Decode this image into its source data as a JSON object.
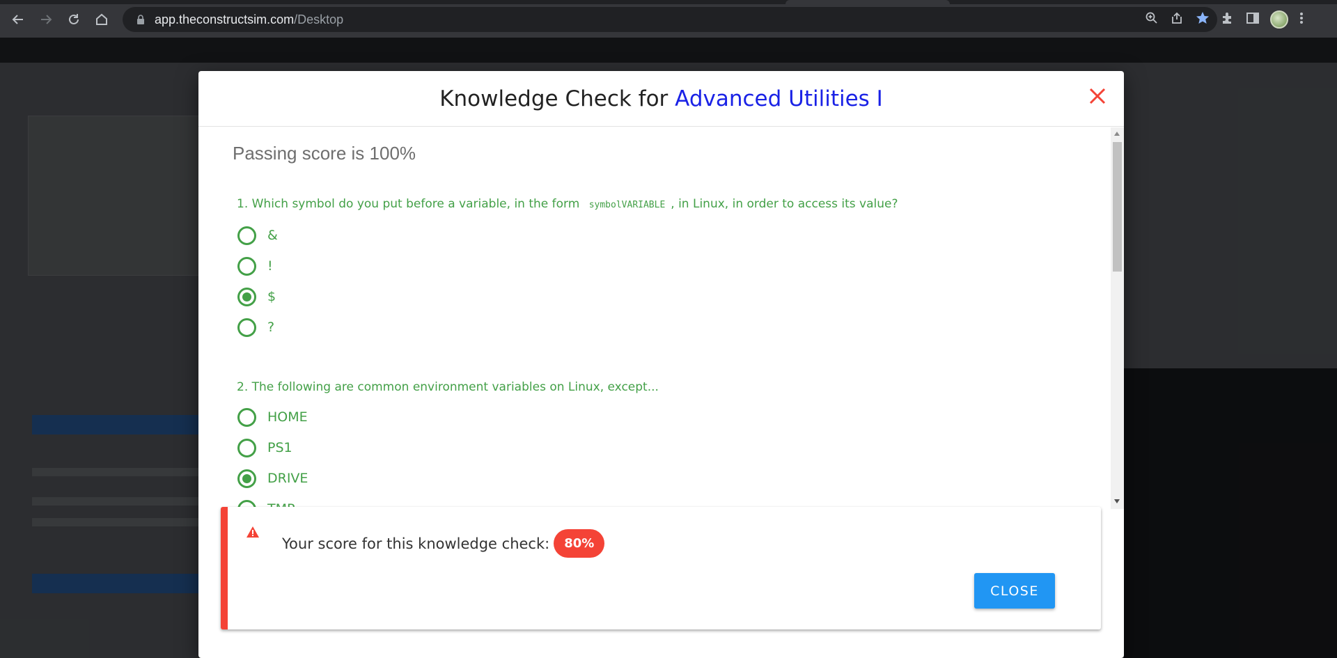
{
  "browser": {
    "url_host": "app.theconstructsim.com",
    "url_path": "/Desktop",
    "icons": [
      "back-icon",
      "forward-icon",
      "reload-icon",
      "home-icon",
      "lock-icon",
      "zoom-icon",
      "share-icon",
      "bookmark-star-icon",
      "extensions-icon",
      "side-panel-icon",
      "profile-avatar",
      "menu-kebab-icon"
    ]
  },
  "modal": {
    "title_prefix": "Knowledge Check for ",
    "title_accent": "Advanced Utilities I",
    "accent_color": "#1a22e6",
    "passing_score": "Passing score is 100%",
    "questions": [
      {
        "text_before": "1. Which symbol do you put before a variable, in the form ",
        "code": "symbolVARIABLE",
        "text_after": ", in Linux, in order to access its value?",
        "options": [
          "&",
          "!",
          "$",
          "?"
        ],
        "selected": "$"
      },
      {
        "text": "2. The following are common environment variables on Linux, except...",
        "options": [
          "HOME",
          "PS1",
          "DRIVE",
          "TMP"
        ],
        "selected": "DRIVE"
      }
    ]
  },
  "result": {
    "label": "Your score for this knowledge check:",
    "score": "80%",
    "close_label": "CLOSE",
    "alert_color": "#f44336",
    "button_color": "#2196f3"
  }
}
